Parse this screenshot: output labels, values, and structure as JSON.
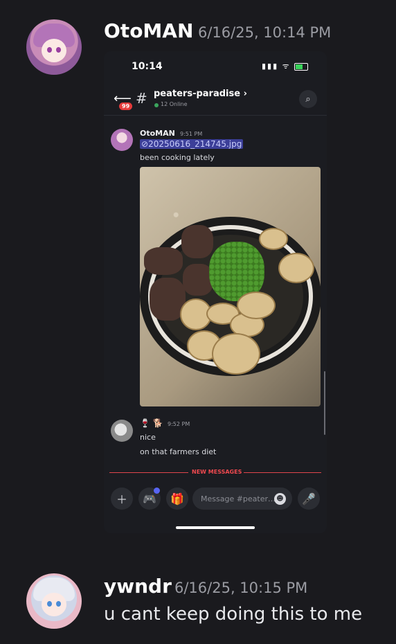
{
  "messages": [
    {
      "user": "OtoMAN",
      "timestamp": "6/16/25, 10:14 PM"
    },
    {
      "user": "ywndr",
      "timestamp": "6/16/25, 10:15 PM",
      "text": "u cant keep doing this to me"
    }
  ],
  "phone": {
    "status_time": "10:14",
    "status_icons": "▮▮▮ ᯤ",
    "unread_badge": "99",
    "channel_name": "peaters-paradise ›",
    "online": "12 Online",
    "post1": {
      "user": "OtoMAN",
      "time": "9:51 PM",
      "attachment": "20250616_214745.jpg",
      "text": "been cooking lately"
    },
    "post2": {
      "emoji": "🍷 🐕",
      "time": "9:52 PM",
      "line1": "nice",
      "line2": "on that farmers diet"
    },
    "new_messages": "NEW MESSAGES",
    "input_placeholder": "Message #peater…",
    "icons": {
      "back": "arrow-left",
      "search": "magnifier",
      "plus": "plus",
      "game": "gamepad",
      "gift": "gift",
      "emoji": "smiley",
      "mic": "microphone"
    }
  }
}
